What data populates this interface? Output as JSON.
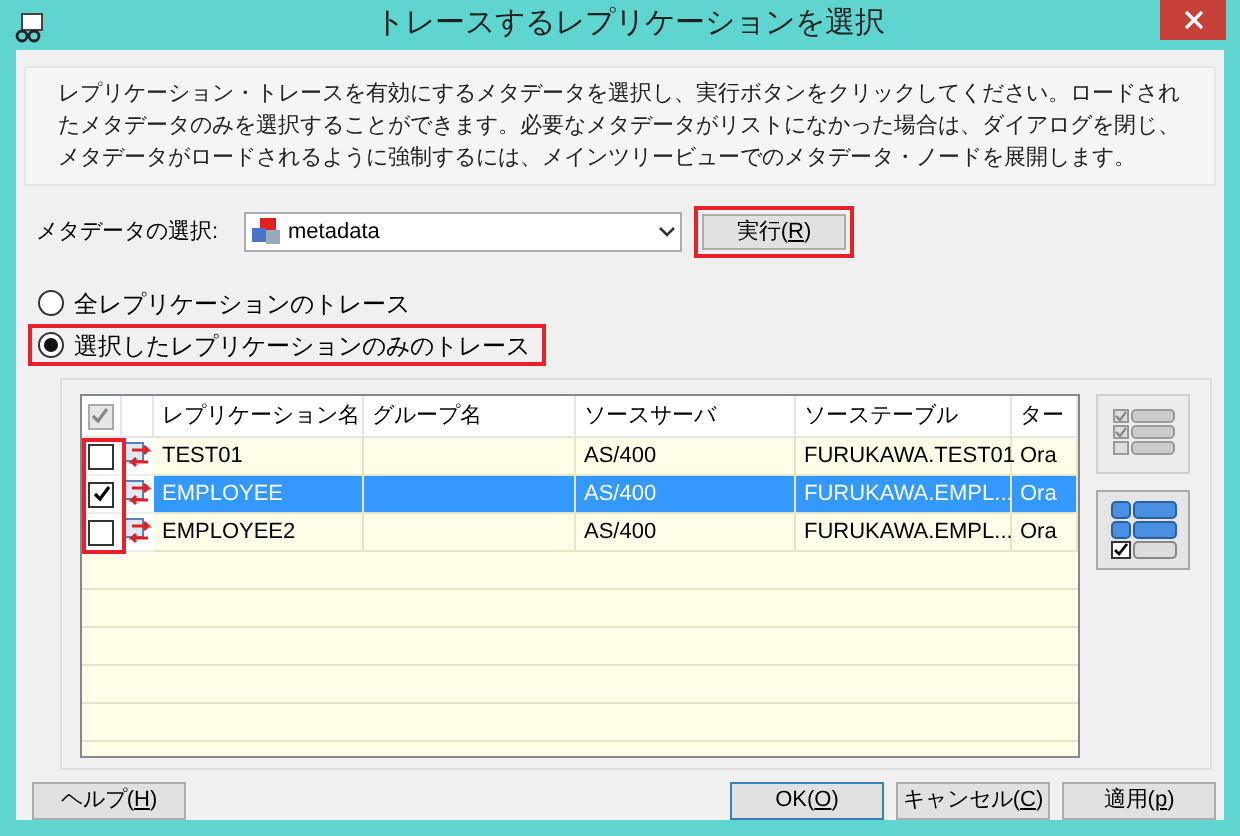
{
  "window": {
    "title": "トレースするレプリケーションを選択"
  },
  "description": "レプリケーション・トレースを有効にするメタデータを選択し、実行ボタンをクリックしてください。ロードされたメタデータのみを選択することができます。必要なメタデータがリストになかった場合は、ダイアログを閉じ、メタデータがロードされるように強制するには、メインツリービューでのメタデータ・ノードを展開します。",
  "metadata_select": {
    "label": "メタデータの選択:",
    "value": "metadata"
  },
  "execute_button": {
    "label": "実行(R)",
    "highlighted": true
  },
  "trace_options": [
    {
      "label": "全レプリケーションのトレース",
      "selected": false,
      "highlighted": false
    },
    {
      "label": "選択したレプリケーションのみのトレース",
      "selected": true,
      "highlighted": true
    }
  ],
  "table": {
    "header_checkbox": {
      "checked": true,
      "disabled": true
    },
    "checkbox_column_highlighted": true,
    "columns": [
      "レプリケーション名",
      "グループ名",
      "ソースサーバ",
      "ソーステーブル",
      "ター"
    ],
    "rows": [
      {
        "checked": false,
        "selected": false,
        "cells": [
          "TEST01",
          "",
          "AS/400",
          "FURUKAWA.TEST01",
          "Ora"
        ]
      },
      {
        "checked": true,
        "selected": true,
        "cells": [
          "EMPLOYEE",
          "",
          "AS/400",
          "FURUKAWA.EMPL...",
          "Ora"
        ]
      },
      {
        "checked": false,
        "selected": false,
        "cells": [
          "EMPLOYEE2",
          "",
          "AS/400",
          "FURUKAWA.EMPL...",
          "Ora"
        ]
      }
    ]
  },
  "buttons": [
    {
      "label": "ヘルプ(H)",
      "kind": "left",
      "default": false
    },
    {
      "label": "OK(O)",
      "kind": "right",
      "default": true
    },
    {
      "label": "キャンセル(C)",
      "kind": "right",
      "default": false
    },
    {
      "label": "適用(p)",
      "kind": "right",
      "default": false
    }
  ]
}
